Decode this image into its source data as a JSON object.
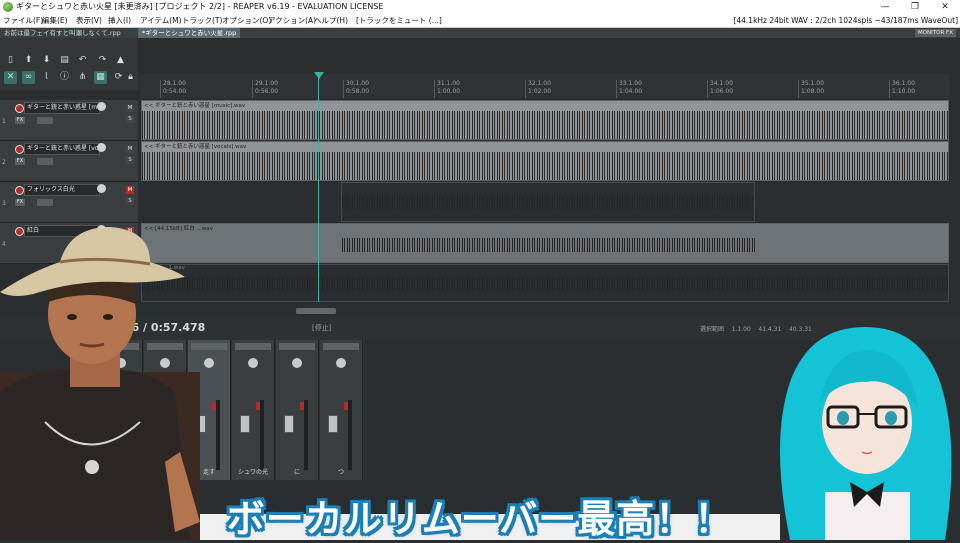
{
  "titlebar": {
    "title": "ギターとシュワと赤い火星 [未更済み] [プロジェクト 2/2] - REAPER v6.19 - EVALUATION LICENSE",
    "minimize": "—",
    "maximize": "❐",
    "close": "✕"
  },
  "menubar": {
    "items": [
      "ファイル(F)",
      "編集(E)",
      "表示(V)",
      "挿入(I)",
      "アイテム(M)",
      "トラック(T)",
      "オプション(O)",
      "アクション(A)",
      "ヘルプ(H)",
      "[トラックをミュート (...]"
    ],
    "status": "[44.1kHz 24bit WAV : 2/2ch 1024spls ~43/187ms WaveOut]"
  },
  "tabs": [
    {
      "label": "お前は最フェイ有すと叫瀬しなくて.rpp"
    },
    {
      "label": "*ギターとシュワと赤い火星.rpp"
    }
  ],
  "monitor_fx": "MONITOR FX",
  "ruler": {
    "ticks": [
      {
        "bar": "28.1.00",
        "time": "0:54.00"
      },
      {
        "bar": "29.1.00",
        "time": "0:56.00"
      },
      {
        "bar": "30.1.00",
        "time": "0:58.00"
      },
      {
        "bar": "31.1.00",
        "time": "1:00.00"
      },
      {
        "bar": "32.1.00",
        "time": "1:02.00"
      },
      {
        "bar": "33.1.00",
        "time": "1:04.00"
      },
      {
        "bar": "34.1.00",
        "time": "1:06.00"
      },
      {
        "bar": "35.1.00",
        "time": "1:08.00"
      },
      {
        "bar": "36.1.00",
        "time": "1:10.00"
      }
    ]
  },
  "tracks": [
    {
      "num": "1",
      "name": "ギターと銃と赤い惑星 [mu",
      "item": "<< ギターと銃と赤い惑星 [music].wav"
    },
    {
      "num": "2",
      "name": "ギターと銃と赤い惑星 [vo",
      "item": "<< ギターと銃と赤い惑星 [vocals].wav"
    },
    {
      "num": "3",
      "name": "フォリックス白光",
      "item": ""
    },
    {
      "num": "4",
      "name": "紅白",
      "item": "<< [44.15kB] 紅白 ...wav"
    },
    {
      "num": "",
      "name": "",
      "item": "4.... 4.... 1.wav"
    }
  ],
  "transport": {
    "time": "3.96 / 0:57.478",
    "state": "[停止]",
    "selection_label": "選択範囲",
    "selection_start": "1.1.00",
    "selection_end": "41.4.31",
    "selection_len": "40.3.31"
  },
  "mixer": {
    "strips": [
      {
        "label": "",
        "fx_label": "FX"
      },
      {
        "label": "",
        "fx_label": "FX"
      },
      {
        "label": "走す",
        "fx_label": "FX"
      },
      {
        "label": "シュワの光",
        "fx_label": "FX"
      },
      {
        "label": "に",
        "fx_label": "FX"
      },
      {
        "label": "つ",
        "fx_label": "FX"
      }
    ]
  },
  "caption": "ボーカルリムーバー最高！！",
  "colors": {
    "accent": "#3fb0a8",
    "caption_outline": "#1a7fb5",
    "record": "#b52b2b"
  }
}
